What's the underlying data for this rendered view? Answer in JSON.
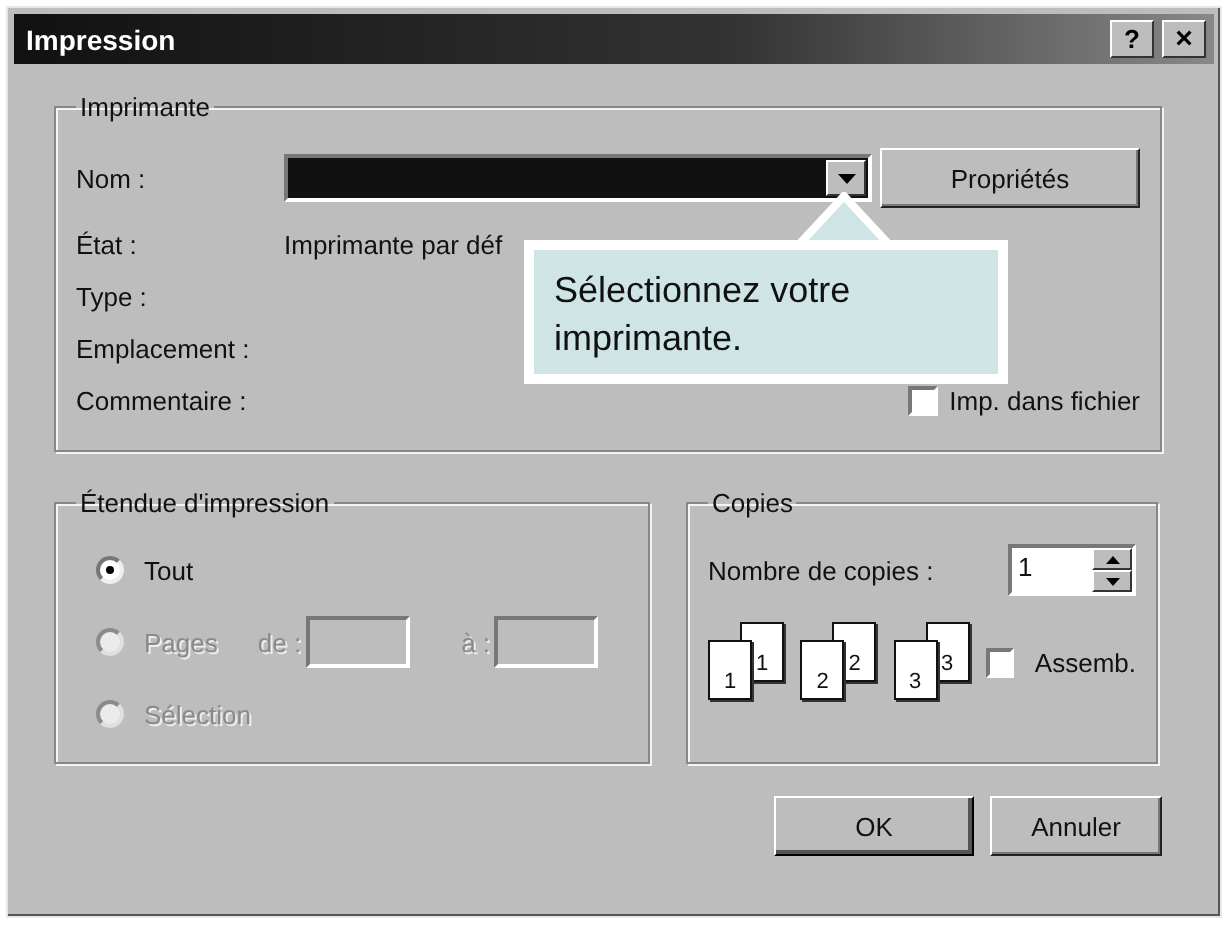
{
  "window": {
    "title": "Impression",
    "buttons": [
      {
        "kind": "help",
        "label": "?"
      },
      {
        "kind": "close",
        "label": "×"
      }
    ]
  },
  "printer": {
    "legend": "Imprimante",
    "name_label": "Nom :",
    "name_value_selected": true,
    "properties_button": "Propriétés",
    "fields": [
      {
        "label": "État :",
        "value": "Imprimante par déf"
      },
      {
        "label": "Type :"
      },
      {
        "label": "Emplacement :"
      },
      {
        "label": "Commentaire :"
      }
    ],
    "print_to_file": {
      "label": "Imp. dans fichier",
      "checked": false
    }
  },
  "tooltip": {
    "text": "Sélectionnez votre imprimante."
  },
  "range": {
    "legend": "Étendue d'impression",
    "options": [
      {
        "label": "Tout",
        "selected": true,
        "disabled": false
      },
      {
        "label": "Pages",
        "selected": false,
        "disabled": true
      },
      {
        "label": "Sélection",
        "selected": false,
        "disabled": true
      }
    ],
    "from_label": "de :",
    "to_label": "à :"
  },
  "copies": {
    "legend": "Copies",
    "count_label": "Nombre de copies :",
    "count": "1",
    "collate_pages": [
      [
        "1",
        "1"
      ],
      [
        "2",
        "2"
      ],
      [
        "3",
        "3"
      ]
    ],
    "collate": {
      "label": "Assemb.",
      "checked": false
    }
  },
  "buttons": [
    "OK",
    "Annuler"
  ]
}
